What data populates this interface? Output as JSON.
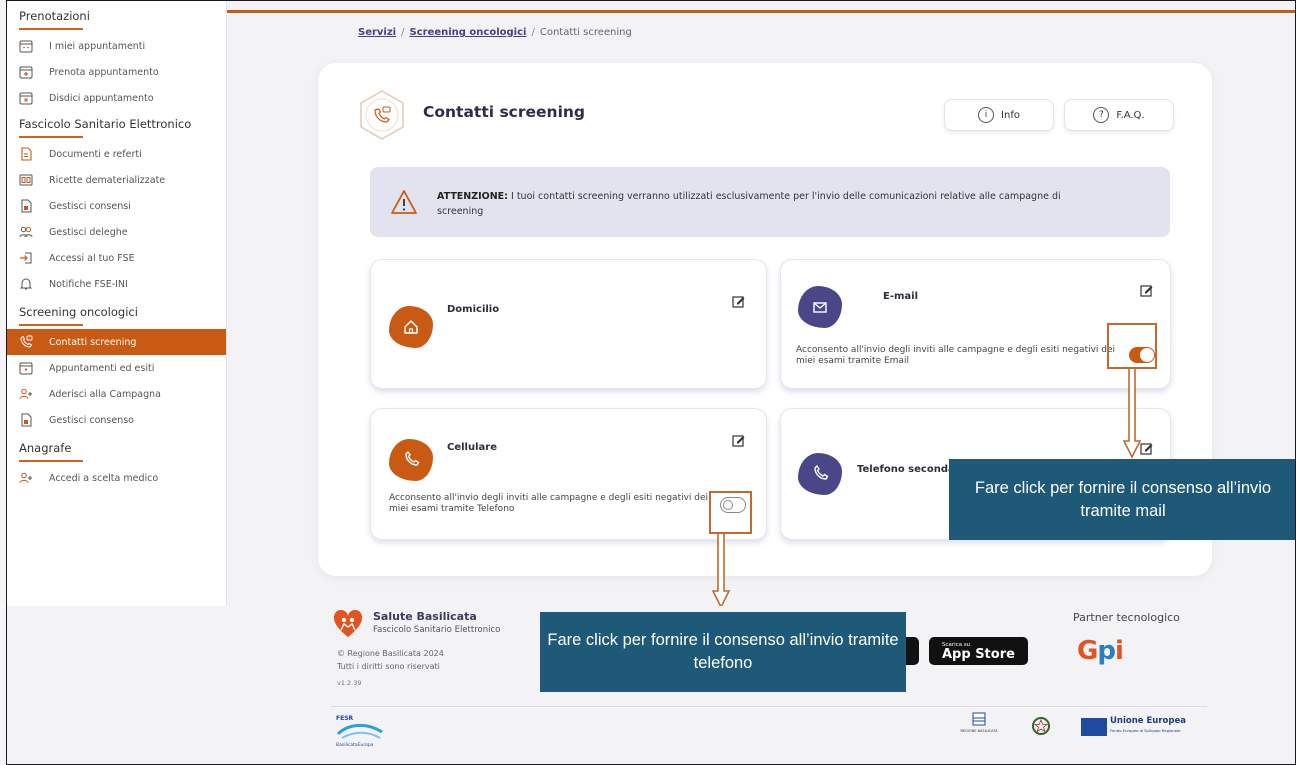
{
  "sidebar": {
    "sections": [
      {
        "title": "Prenotazioni",
        "items": [
          "I miei appuntamenti",
          "Prenota appuntamento",
          "Disdici appuntamento"
        ]
      },
      {
        "title": "Fascicolo Sanitario Elettronico",
        "items": [
          "Documenti e referti",
          "Ricette dematerializzate",
          "Gestisci consensi",
          "Gestisci deleghe",
          "Accessi al tuo FSE",
          "Notifiche FSE-INI"
        ]
      },
      {
        "title": "Screening oncologici",
        "items": [
          "Contatti screening",
          "Appuntamenti ed esiti",
          "Aderisci alla Campagna",
          "Gestisci consenso"
        ]
      },
      {
        "title": "Anagrafe",
        "items": [
          "Accedi a scelta medico"
        ]
      }
    ],
    "active_item": "Contatti screening"
  },
  "breadcrumb": {
    "items": [
      "Servizi",
      "Screening oncologici"
    ],
    "current": "Contatti screening"
  },
  "page": {
    "title": "Contatti screening",
    "buttons": {
      "info": "Info",
      "faq": "F.A.Q."
    }
  },
  "alert": {
    "strong": "ATTENZIONE:",
    "text": " I tuoi contatti screening verranno utilizzati esclusivamente per l'invio delle comunicazioni relative alle campagne di screening"
  },
  "cards": {
    "domicilio": {
      "title": "Domicilio"
    },
    "email": {
      "title": "E-mail",
      "consent": "Acconsento all'invio degli inviti alle campagne e degli esiti negativi dei miei esami tramite Email",
      "consent_on": true
    },
    "cellulare": {
      "title": "Cellulare",
      "consent": "Acconsento all'invio degli inviti alle campagne e degli esiti negativi dei miei esami tramite Telefono",
      "consent_on": false
    },
    "telefono": {
      "title": "Telefono seconda"
    }
  },
  "callouts": {
    "mail": "Fare click per fornire il consenso all’invio tramite mail",
    "tel": "Fare click per fornire il consenso all’invio tramite telefono"
  },
  "footer": {
    "brand": "Salute Basilicata",
    "brand_sub": "Fascicolo Sanitario Elettronico",
    "copyright": "© Regione Basilicata 2024",
    "rights": "Tutti i diritti sono riservati",
    "version": "v1.2.39",
    "app_store_small": "Scarica su",
    "app_store": "App Store",
    "partner_label": "Partner tecnologico",
    "partner": "GPI",
    "fesr": "FESR",
    "basilicata_europa": "BasilicataEuropa",
    "regione": "REGIONE BASILICATA",
    "eu": "Unione Europea",
    "eu_sub": "Fondo Europeo di Sviluppo Regionale"
  },
  "colors": {
    "accent": "#c95a14",
    "purple": "#4b4688",
    "callout": "#1e5a78"
  }
}
